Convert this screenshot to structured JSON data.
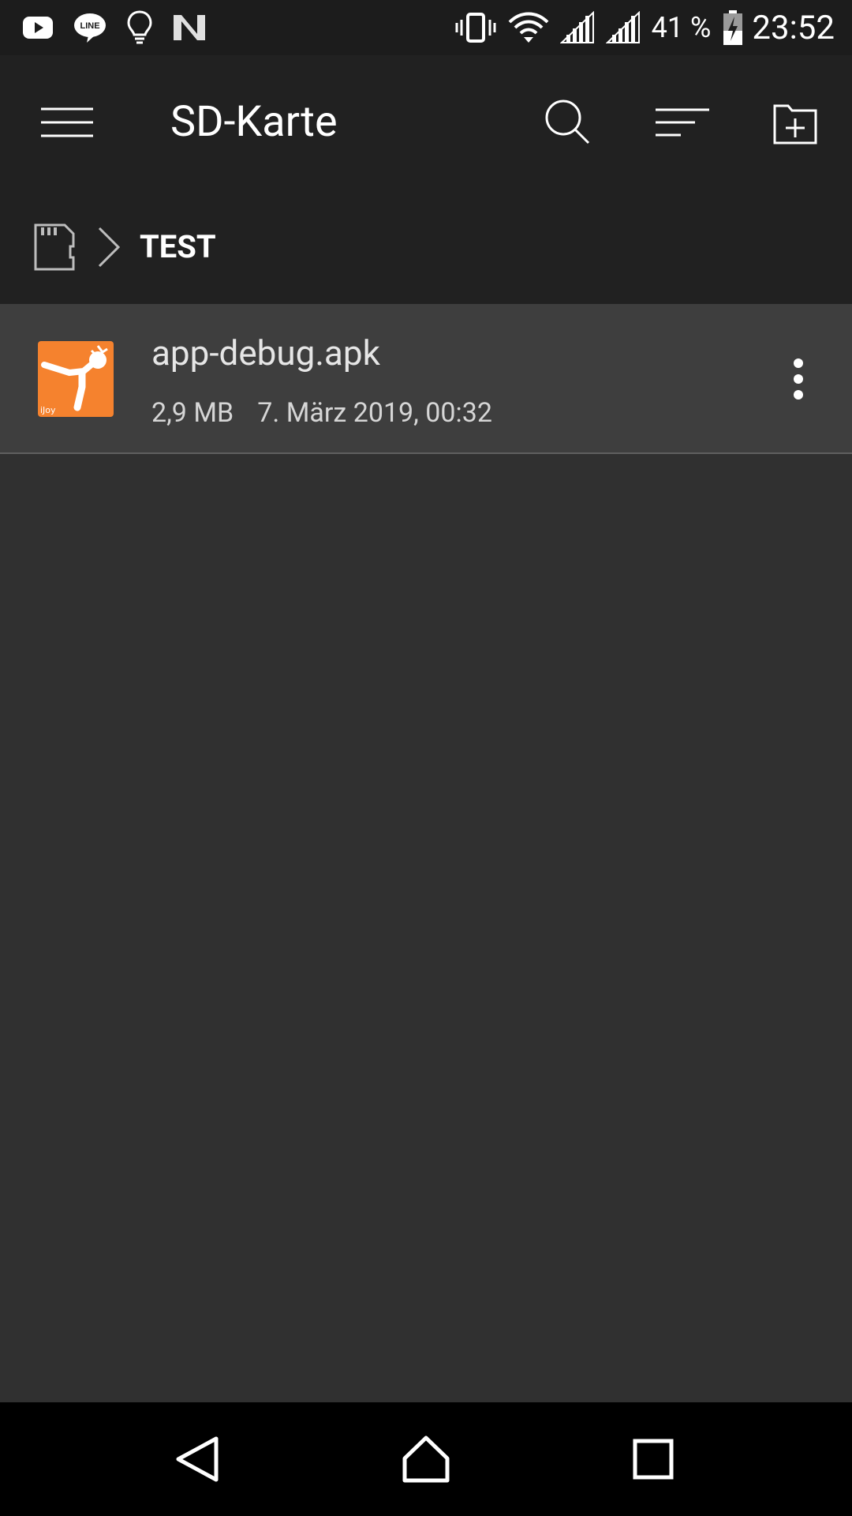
{
  "status_bar": {
    "left_icons": [
      "youtube-icon",
      "line-icon",
      "lightbulb-icon",
      "n-notification-icon"
    ],
    "right_icons": [
      "vibrate-icon",
      "wifi-icon",
      "signal-icon",
      "signal-icon",
      "battery-charging-icon"
    ],
    "battery_percent": "41 %",
    "time": "23:52"
  },
  "toolbar": {
    "title": "SD-Karte",
    "icons": [
      "menu-icon",
      "search-icon",
      "sort-icon",
      "new-folder-icon"
    ]
  },
  "breadcrumb": {
    "root_icon": "sd-card-icon",
    "separator_icon": "chevron-right-icon",
    "current": "TEST"
  },
  "files": [
    {
      "name": "app-debug.apk",
      "size": "2,9 MB",
      "date": "7. März 2019, 00:32",
      "icon": "apk-app-icon",
      "thumb_label": "iJoy"
    }
  ],
  "nav_bar": {
    "icons": [
      "back-icon",
      "home-icon",
      "recents-icon"
    ]
  },
  "colors": {
    "status_bar": "#1c1c1c",
    "app_bar": "#212121",
    "background": "#303030",
    "row": "#3e3e3e",
    "thumb_accent": "#f5822e",
    "nav_bar": "#000000"
  }
}
